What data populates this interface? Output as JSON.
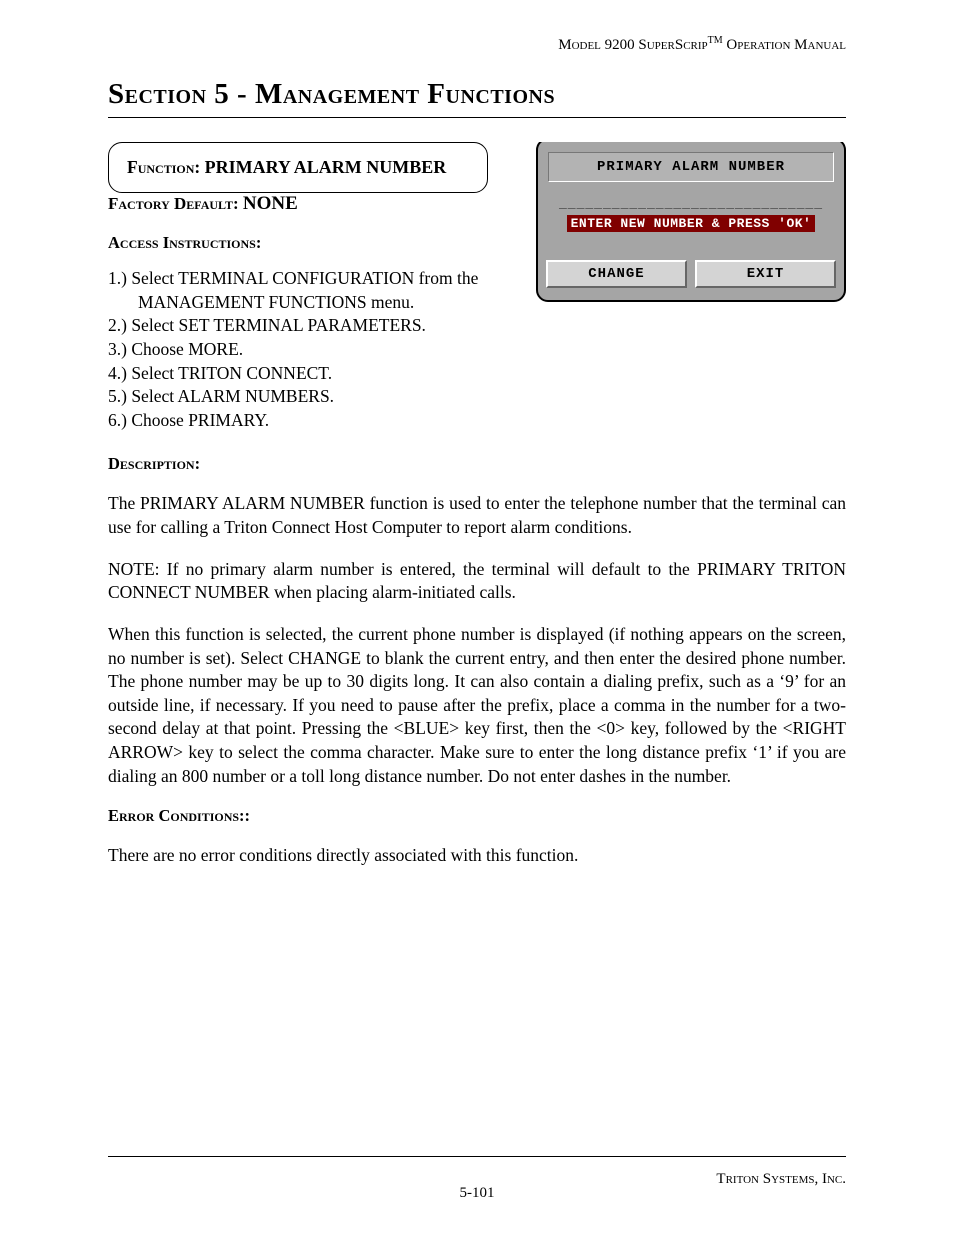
{
  "header": {
    "model": "Model 9200 SuperScrip",
    "suffix": " Operation Manual",
    "tm": "TM"
  },
  "section_title": "Section 5 - Management Functions",
  "function_box": {
    "label": "Function:  ",
    "name": "PRIMARY ALARM NUMBER"
  },
  "terminal": {
    "title": "PRIMARY ALARM NUMBER",
    "dashes": "______________________________",
    "prompt": "ENTER NEW NUMBER & PRESS 'OK'",
    "btn_change": "CHANGE",
    "btn_exit": "EXIT"
  },
  "factory_default": {
    "label": "Factory Default: ",
    "value": "NONE"
  },
  "access_label": "Access Instructions:",
  "steps": [
    "1.) Select TERMINAL CONFIGURATION from the MANAGEMENT FUNCTIONS menu.",
    "2.) Select SET TERMINAL PARAMETERS.",
    "3.) Choose MORE.",
    "4.) Select TRITON CONNECT.",
    "5.) Select ALARM NUMBERS.",
    "6.) Choose PRIMARY."
  ],
  "description_label": "Description:",
  "description_p1": "The PRIMARY ALARM NUMBER function is used to enter the telephone number that the terminal can use for calling a Triton Connect Host Computer to report alarm conditions.",
  "description_p2": "NOTE: If no primary alarm number is entered, the terminal will default to the PRIMARY TRITON CONNECT NUMBER when placing alarm-initiated calls.",
  "description_p3": "When this function is selected, the current phone number is displayed (if nothing appears on the screen, no number is set).  Select CHANGE to blank the current entry, and then enter the desired phone number.  The phone number may be up to 30 digits long.  It can also contain a dialing prefix, such as a ‘9’ for an outside line, if necessary.  If you need to pause after the prefix, place a comma in the number for a two-second delay at that point.  Pressing the <BLUE> key first, then the <0> key, followed by the <RIGHT ARROW> key to select the comma character.  Make sure to enter the long distance prefix ‘1’ if you are dialing an 800 number or a toll long distance number.  Do not enter dashes in the number.",
  "error_label": "Error Conditions::",
  "error_text": "There are no error conditions directly associated with this function.",
  "footer": {
    "page": "5-101",
    "company": "Triton Systems, Inc."
  }
}
